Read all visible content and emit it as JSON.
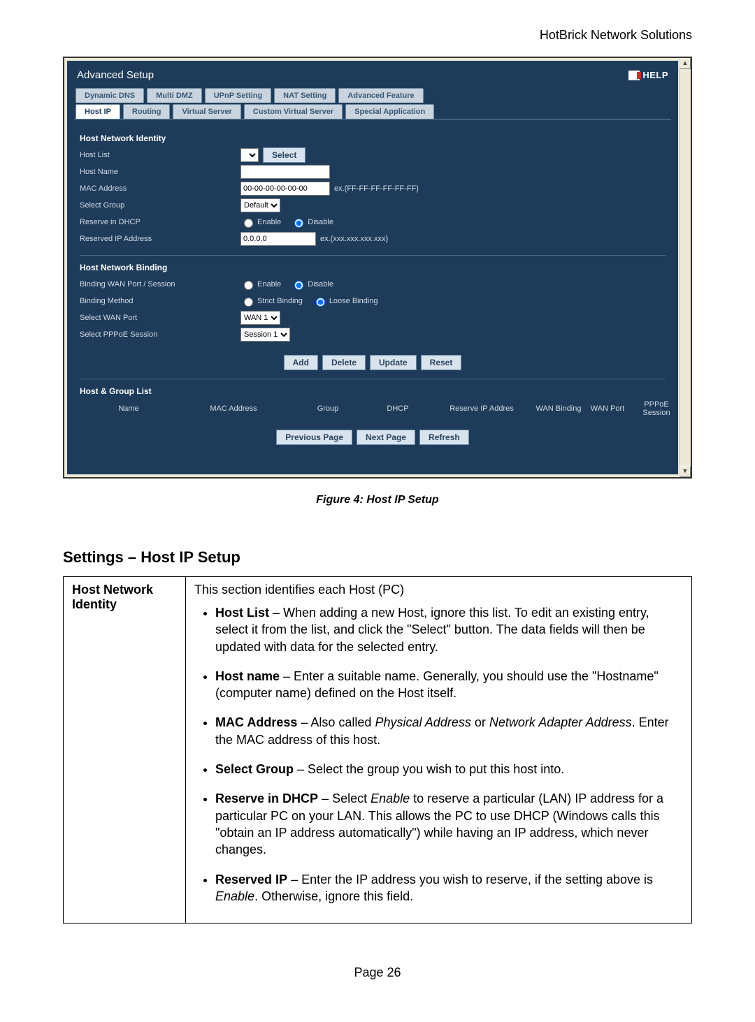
{
  "header": "HotBrick Network Solutions",
  "app": {
    "title": "Advanced Setup",
    "help_label": "HELP",
    "tabs1": [
      "Dynamic DNS",
      "Multi DMZ",
      "UPnP Setting",
      "NAT Setting",
      "Advanced Feature"
    ],
    "tabs2": [
      "Host IP",
      "Routing",
      "Virtual Server",
      "Custom Virtual Server",
      "Special Application"
    ],
    "active_tab": "Host IP",
    "identity": {
      "section": "Host Network Identity",
      "host_list_label": "Host List",
      "select_btn": "Select",
      "host_name_label": "Host Name",
      "host_name_value": "",
      "mac_label": "MAC Address",
      "mac_value": "00-00-00-00-00-00",
      "mac_hint": "ex.(FF-FF-FF-FF-FF-FF)",
      "group_label": "Select Group",
      "group_value": "Default",
      "dhcp_label": "Reserve in DHCP",
      "dhcp_enable": "Enable",
      "dhcp_disable": "Disable",
      "resip_label": "Reserved IP Address",
      "resip_value": "0.0.0.0",
      "resip_hint": "ex.(xxx.xxx.xxx.xxx)"
    },
    "binding": {
      "section": "Host Network Binding",
      "wan_sess_label": "Binding WAN Port / Session",
      "enable": "Enable",
      "disable": "Disable",
      "method_label": "Binding Method",
      "strict": "Strict Binding",
      "loose": "Loose Binding",
      "sel_wan_label": "Select WAN Port",
      "sel_wan_value": "WAN 1",
      "sel_pppoe_label": "Select PPPoE Session",
      "sel_pppoe_value": "Session 1"
    },
    "action_btns": [
      "Add",
      "Delete",
      "Update",
      "Reset"
    ],
    "list": {
      "section": "Host & Group List",
      "cols": [
        "Name",
        "MAC Address",
        "Group",
        "DHCP",
        "Reserve IP Addres",
        "WAN Binding",
        "WAN Port",
        "PPPoE Session"
      ]
    },
    "nav_btns": [
      "Previous Page",
      "Next Page",
      "Refresh"
    ]
  },
  "figure_caption": "Figure 4: Host IP Setup",
  "settings_title": "Settings – Host IP Setup",
  "settings_table": {
    "row_label": "Host Network Identity",
    "intro": "This section identifies each Host (PC)",
    "items": [
      {
        "term": "Host List",
        "rest": " – When adding a new Host, ignore this list. To edit an existing entry, select it from the list, and click the \"Select\" button. The data fields will then be updated with data for the selected entry."
      },
      {
        "term": "Host name",
        "rest": " – Enter a suitable name. Generally, you should use the \"Hostname\" (computer name) defined on the Host itself."
      },
      {
        "term": "MAC Address",
        "rest_pre": " – Also called ",
        "i1": "Physical Address",
        "mid": " or ",
        "i2": "Network Adapter Address",
        "rest_post": ". Enter the MAC address of this host."
      },
      {
        "term": "Select Group",
        "rest": " – Select the group you wish to put this host into."
      },
      {
        "term": "Reserve in DHCP",
        "rest_pre": " – Select ",
        "i1": "Enable",
        "rest_post": " to reserve a particular (LAN) IP address for a particular PC on your LAN. This allows the PC to use DHCP (Windows calls this \"obtain an IP address automatically\") while having an IP address, which never changes."
      },
      {
        "term": "Reserved IP",
        "rest_pre": " – Enter the IP address you wish to reserve, if the setting above is ",
        "i1": "Enable",
        "rest_post": ". Otherwise, ignore this field."
      }
    ]
  },
  "page_number": "Page 26"
}
